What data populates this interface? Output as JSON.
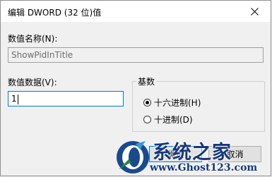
{
  "window": {
    "title": "编辑 DWORD (32 位)值"
  },
  "value_name": {
    "label": "数值名称(N):",
    "value": "ShowPidInTitle"
  },
  "value_data": {
    "label": "数值数据(V):",
    "value": "1"
  },
  "base": {
    "title": "基数",
    "options": [
      {
        "label": "十六进制(H)",
        "selected": true
      },
      {
        "label": "十进制(D)",
        "selected": false
      }
    ]
  },
  "buttons": {
    "ok_label": "确定",
    "cancel_label": "取消"
  },
  "watermark": {
    "main": "系统之家",
    "sub": "www.Ghost123.com"
  },
  "colors": {
    "focus_border": "#0078d7",
    "watermark_blue": "#16377a",
    "dialog_bg": "#f0f0f0"
  }
}
